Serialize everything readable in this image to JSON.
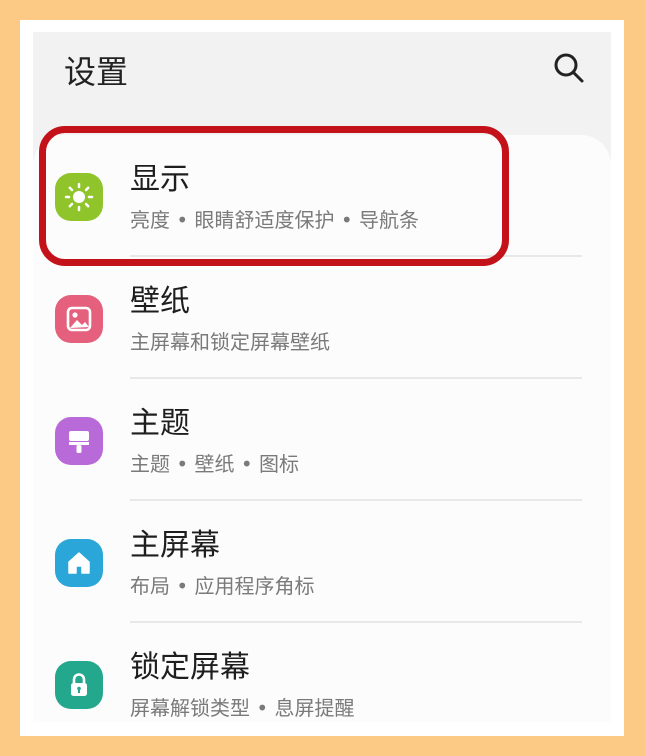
{
  "header": {
    "title": "设置",
    "search_icon": "search-icon"
  },
  "colors": {
    "display": "#8fc42a",
    "wallpaper": "#e4607c",
    "themes": "#b86ad8",
    "homescreen": "#2aa6d8",
    "lockscreen": "#24a88d",
    "highlight": "#c4121a"
  },
  "items": [
    {
      "title": "显示",
      "subtitle": "亮度 • 眼睛舒适度保护 • 导航条",
      "icon": "sun-icon"
    },
    {
      "title": "壁纸",
      "subtitle": "主屏幕和锁定屏幕壁纸",
      "icon": "image-icon"
    },
    {
      "title": "主题",
      "subtitle": "主题 • 壁纸 • 图标",
      "icon": "paint-brush-icon"
    },
    {
      "title": "主屏幕",
      "subtitle": "布局 • 应用程序角标",
      "icon": "home-icon"
    },
    {
      "title": "锁定屏幕",
      "subtitle": "屏幕解锁类型 • 息屏提醒",
      "icon": "lock-icon"
    }
  ]
}
